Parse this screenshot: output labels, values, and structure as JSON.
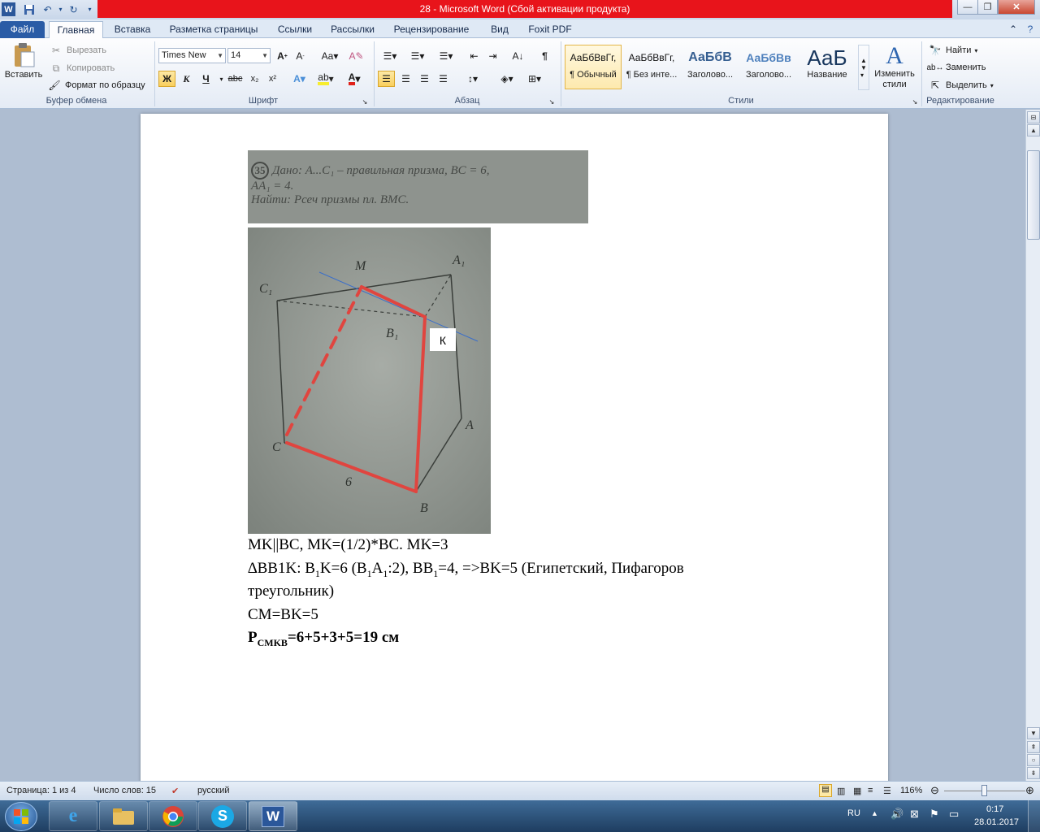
{
  "window": {
    "title": "28  -  Microsoft Word (Сбой активации продукта)"
  },
  "tabs": [
    {
      "label": "Файл"
    },
    {
      "label": "Главная"
    },
    {
      "label": "Вставка"
    },
    {
      "label": "Разметка страницы"
    },
    {
      "label": "Ссылки"
    },
    {
      "label": "Рассылки"
    },
    {
      "label": "Рецензирование"
    },
    {
      "label": "Вид"
    },
    {
      "label": "Foxit PDF"
    }
  ],
  "clipboard": {
    "paste": "Вставить",
    "cut": "Вырезать",
    "copy": "Копировать",
    "format_painter": "Формат по образцу",
    "group": "Буфер обмена"
  },
  "font": {
    "name": "Times New Roman",
    "size": "14",
    "bold": "Ж",
    "italic": "К",
    "underline": "Ч",
    "strike": "abc",
    "group": "Шрифт"
  },
  "paragraph": {
    "group": "Абзац"
  },
  "styles": {
    "items": [
      {
        "sample": "АаБбВвГг,",
        "name": "¶ Обычный"
      },
      {
        "sample": "АаБбВвГг,",
        "name": "¶ Без инте..."
      },
      {
        "sample": "АаБбВ",
        "name": "Заголово..."
      },
      {
        "sample": "АаБбВв",
        "name": "Заголово..."
      },
      {
        "sample": "АаБ",
        "name": "Название"
      }
    ],
    "change": "Изменить стили",
    "group": "Стили"
  },
  "editing": {
    "find": "Найти",
    "replace": "Заменить",
    "select": "Выделить",
    "group": "Редактирование"
  },
  "document": {
    "given_image": {
      "num": "35",
      "line1": "Дано: A...C₁ – правильная призма, BC = 6,",
      "line2": "AA₁ = 4.",
      "line3": "Найти: Pсеч призмы пл. BMC."
    },
    "diagram": {
      "label_k": "К",
      "c1": "C₁",
      "m": "M",
      "a1": "A₁",
      "b1": "B₁",
      "c": "C",
      "a": "A",
      "b": "B",
      "six": "6"
    },
    "line1": "MK||BC, MK=(1/2)*BC. MK=3",
    "line2_pre": "∆BB1K: B",
    "line2_s1": "1",
    "line2_a": "K=6 (B",
    "line2_s2": "1",
    "line2_b": "A",
    "line2_s3": "1",
    "line2_c": ":2), BB",
    "line2_s4": "1",
    "line2_d": "=4, =>BK=5 (Египетский, Пифагоров",
    "line3": "треугольник)",
    "line4": "CM=BK=5",
    "line5_p": "P",
    "line5_sub": "CMKB",
    "line5_rest": "=6+5+3+5=19 см"
  },
  "status": {
    "page": "Страница: 1 из 4",
    "words": "Число слов: 15",
    "lang": "русский",
    "zoom": "116%"
  },
  "tray": {
    "lang": "RU",
    "time": "0:17",
    "date": "28.01.2017"
  }
}
